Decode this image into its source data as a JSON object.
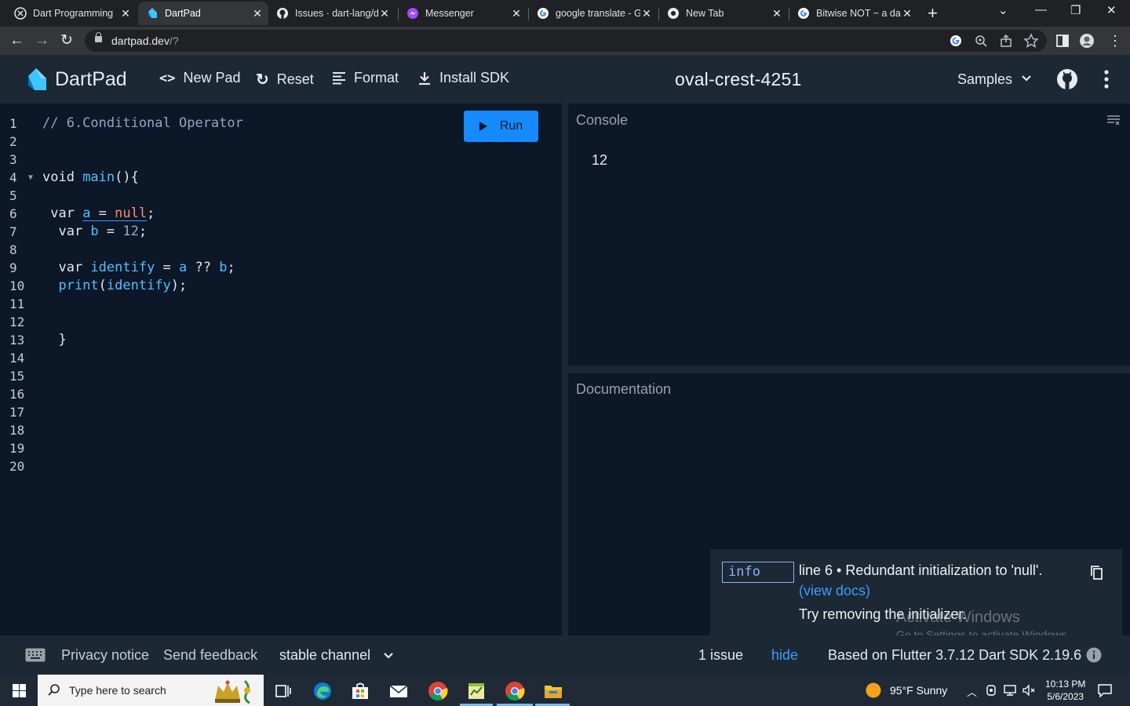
{
  "browser": {
    "tabs": [
      {
        "title": "Dart Programming",
        "icon": "dart-docs-icon",
        "active": false
      },
      {
        "title": "DartPad",
        "icon": "dartpad-icon",
        "active": true
      },
      {
        "title": "Issues · dart-lang/d",
        "icon": "github-icon",
        "active": false
      },
      {
        "title": "Messenger",
        "icon": "messenger-icon",
        "active": false
      },
      {
        "title": "google translate - G",
        "icon": "google-icon",
        "active": false
      },
      {
        "title": "New Tab",
        "icon": "chrome-icon",
        "active": false
      },
      {
        "title": "Bitwise NOT ~ a da",
        "icon": "google-icon",
        "active": false
      }
    ],
    "url_host": "dartpad.dev",
    "url_path": "/?"
  },
  "header": {
    "brand": "DartPad",
    "new_pad": "New Pad",
    "reset": "Reset",
    "format": "Format",
    "install_sdk": "Install SDK",
    "pad_name": "oval-crest-4251",
    "samples": "Samples"
  },
  "editor": {
    "run_label": "Run",
    "line_numbers": [
      "1",
      "2",
      "3",
      "4",
      "5",
      "6",
      "7",
      "8",
      "9",
      "10",
      "11",
      "12",
      "13",
      "14",
      "15",
      "16",
      "17",
      "18",
      "19",
      "20"
    ],
    "code": {
      "l1": "// 6.Conditional Operator",
      "l4_kw": "void ",
      "l4_fn": "main",
      "l4_rest": "(){",
      "l6_kw": " var ",
      "l6_var": "a",
      "l6_eq": " = ",
      "l6_null": "null",
      "l6_end": ";",
      "l7_kw": "  var ",
      "l7_var": "b",
      "l7_eq": " = ",
      "l7_num": "12",
      "l7_end": ";",
      "l9_kw": "  var ",
      "l9_var": "identify",
      "l9_eq": " = ",
      "l9_a": "a",
      "l9_op": " ?? ",
      "l9_b": "b",
      "l9_end": ";",
      "l10_fn": "  print",
      "l10_p1": "(",
      "l10_arg": "identify",
      "l10_p2": ");",
      "l13": "  }"
    }
  },
  "console": {
    "title": "Console",
    "output": "12"
  },
  "documentation": {
    "title": "Documentation"
  },
  "issue": {
    "badge": "info",
    "message": "line 6 • Redundant initialization to 'null'.",
    "view_docs": "(view docs)",
    "fix": "Try removing the initializer."
  },
  "watermark": {
    "line1": "Activate Windows",
    "line2": "Go to Settings to activate Windows."
  },
  "footer": {
    "privacy": "Privacy notice",
    "feedback": "Send feedback",
    "channel": "stable channel",
    "issues": "1 issue",
    "hide": "hide",
    "version": "Based on Flutter 3.7.12 Dart SDK 2.19.6"
  },
  "taskbar": {
    "search_placeholder": "Type here to search",
    "weather": "95°F  Sunny",
    "time": "10:13 PM",
    "date": "5/6/2023"
  },
  "colors": {
    "accent": "#168afd",
    "background": "#0c1728",
    "panel": "#1c2834",
    "link": "#3d9dff"
  }
}
